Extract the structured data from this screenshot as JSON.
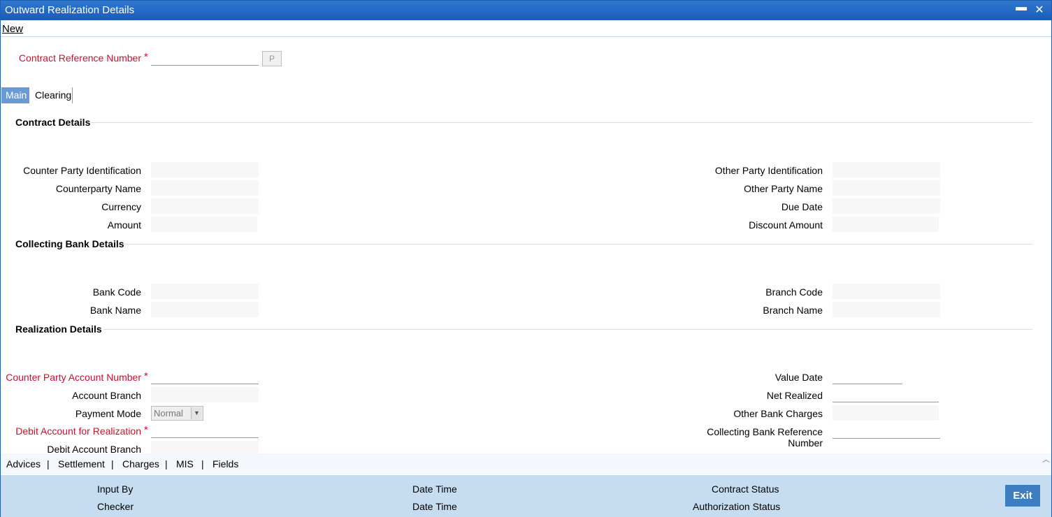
{
  "window": {
    "title": "Outward Realization Details"
  },
  "menu": {
    "new_label": "New"
  },
  "header": {
    "contract_ref_label": "Contract Reference Number",
    "required_mark": "*",
    "p_button": "P"
  },
  "tabs": [
    {
      "label": "Main",
      "active": true
    },
    {
      "label": "Clearing",
      "active": false
    }
  ],
  "contract_details": {
    "title": "Contract Details",
    "counter_party_id": "Counter Party Identification",
    "counterparty_name": "Counterparty Name",
    "currency": "Currency",
    "amount": "Amount",
    "other_party_id": "Other Party Identification",
    "other_party_name": "Other Party Name",
    "due_date": "Due Date",
    "discount_amount": "Discount Amount"
  },
  "collecting_bank": {
    "title": "Collecting Bank Details",
    "bank_code": "Bank Code",
    "bank_name": "Bank Name",
    "branch_code": "Branch Code",
    "branch_name": "Branch Name"
  },
  "realization": {
    "title": "Realization Details",
    "cp_account_number": "Counter Party Account Number",
    "account_branch": "Account Branch",
    "payment_mode": "Payment Mode",
    "payment_mode_value": "Normal",
    "debit_account": "Debit Account for Realization",
    "debit_account_branch": "Debit Account Branch",
    "value_date": "Value Date",
    "net_realized": "Net Realized",
    "other_bank_charges": "Other Bank Charges",
    "collecting_bank_ref_line1": "Collecting Bank Reference",
    "collecting_bank_ref_line2": "Number"
  },
  "bottom_links": [
    "Advices",
    "Settlement",
    "Charges",
    "MIS",
    "Fields"
  ],
  "footer": {
    "input_by": "Input By",
    "checker": "Checker",
    "date_time_1": "Date Time",
    "date_time_2": "Date Time",
    "contract_status": "Contract Status",
    "authorization_status": "Authorization Status",
    "exit": "Exit"
  },
  "colors": {
    "titlebar": "#1a5cb8",
    "required": "#c8102e",
    "footer": "#c6dcf0",
    "exit_button": "#3d7ec1",
    "active_tab": "#6a9ad4"
  }
}
